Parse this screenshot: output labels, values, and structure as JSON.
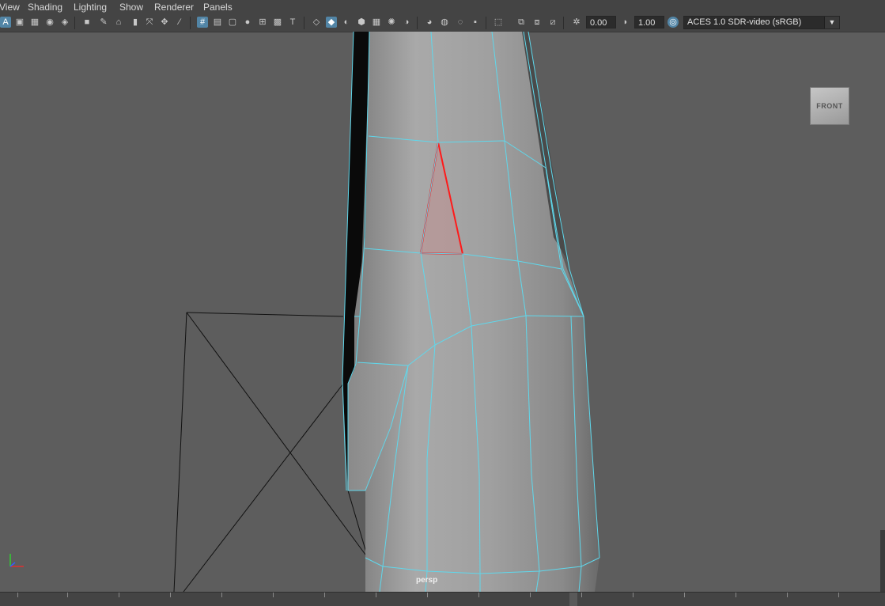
{
  "menu": {
    "view": "View",
    "shading": "Shading",
    "lighting": "Lighting",
    "show": "Show",
    "renderer": "Renderer",
    "panels": "Panels"
  },
  "toolbar": {
    "exposure_value": "0.00",
    "gamma_value": "1.00",
    "color_space": "ACES 1.0 SDR-video (sRGB)",
    "icons": [
      "select-camera-icon",
      "camera-attributes-icon",
      "bookmark-icon",
      "image-plane-icon",
      "grid-icon",
      "film-gate-icon",
      "resolution-gate-icon",
      "gate-mask-icon",
      "field-chart-icon",
      "safe-action-icon",
      "safe-title-icon",
      "wireframe-icon",
      "smooth-shade-icon",
      "textures-icon",
      "use-all-lights-icon",
      "shadows-icon",
      "isolate-select-icon",
      "xray-icon",
      "exposure-icon",
      "gamma-icon",
      "color-management-icon"
    ]
  },
  "viewport": {
    "view_cube_label": "FRONT",
    "camera_name": "persp",
    "wire_color": "#5fd8ec",
    "selection_color": "#ff1a1a",
    "axis_x_color": "#e03030",
    "axis_y_color": "#30d030"
  }
}
